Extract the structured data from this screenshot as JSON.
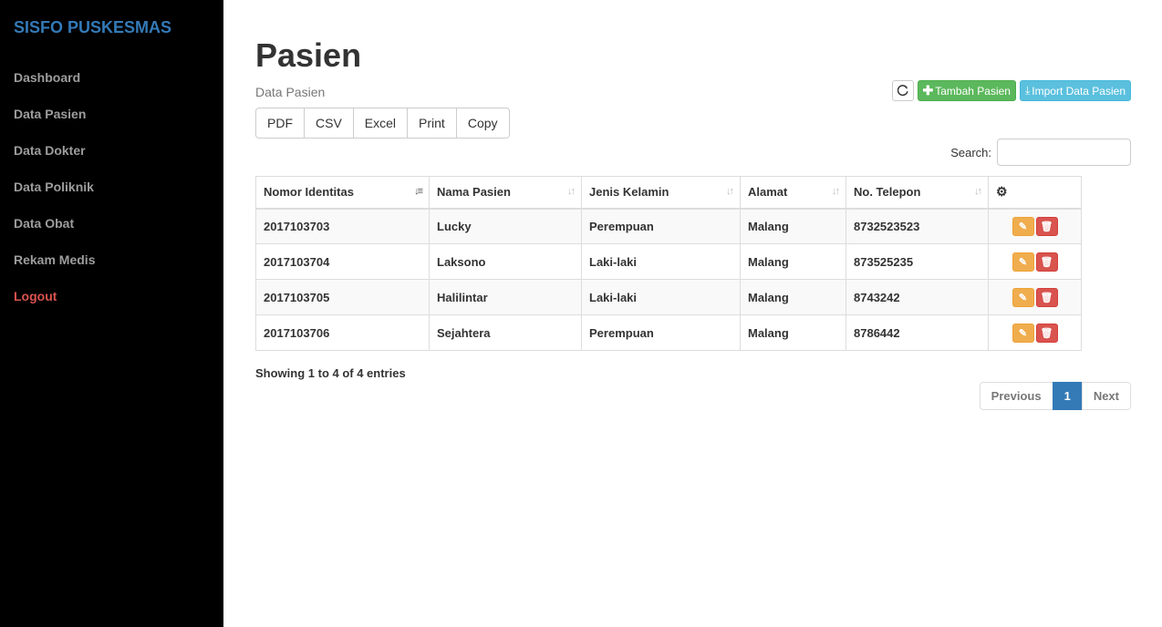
{
  "sidebar": {
    "brand": "SISFO PUSKESMAS",
    "items": [
      {
        "label": "Dashboard"
      },
      {
        "label": "Data Pasien"
      },
      {
        "label": "Data Dokter"
      },
      {
        "label": "Data Poliknik"
      },
      {
        "label": "Data Obat"
      },
      {
        "label": "Rekam Medis"
      },
      {
        "label": "Logout"
      }
    ]
  },
  "header": {
    "title": "Pasien",
    "subtitle": "Data Pasien"
  },
  "actions": {
    "refresh_icon": "refresh-icon",
    "add_label": "Tambah Pasien",
    "import_label": "Import Data Pasien"
  },
  "export": {
    "pdf": "PDF",
    "csv": "CSV",
    "excel": "Excel",
    "print": "Print",
    "copy": "Copy"
  },
  "search": {
    "label": "Search:",
    "value": ""
  },
  "table": {
    "columns": [
      "Nomor Identitas",
      "Nama Pasien",
      "Jenis Kelamin",
      "Alamat",
      "No. Telepon"
    ],
    "rows": [
      {
        "id": "2017103703",
        "nama": "Lucky",
        "jk": "Perempuan",
        "alamat": "Malang",
        "telp": "8732523523"
      },
      {
        "id": "2017103704",
        "nama": "Laksono",
        "jk": "Laki-laki",
        "alamat": "Malang",
        "telp": "873525235"
      },
      {
        "id": "2017103705",
        "nama": "Halilintar",
        "jk": "Laki-laki",
        "alamat": "Malang",
        "telp": "8743242"
      },
      {
        "id": "2017103706",
        "nama": "Sejahtera",
        "jk": "Perempuan",
        "alamat": "Malang",
        "telp": "8786442"
      }
    ]
  },
  "footer": {
    "info": "Showing 1 to 4 of 4 entries",
    "previous": "Previous",
    "page": "1",
    "next": "Next"
  },
  "colors": {
    "brand": "#337ab7",
    "success": "#5cb85c",
    "info": "#5bc0de",
    "warning": "#f0ad4e",
    "danger": "#d9534f"
  }
}
